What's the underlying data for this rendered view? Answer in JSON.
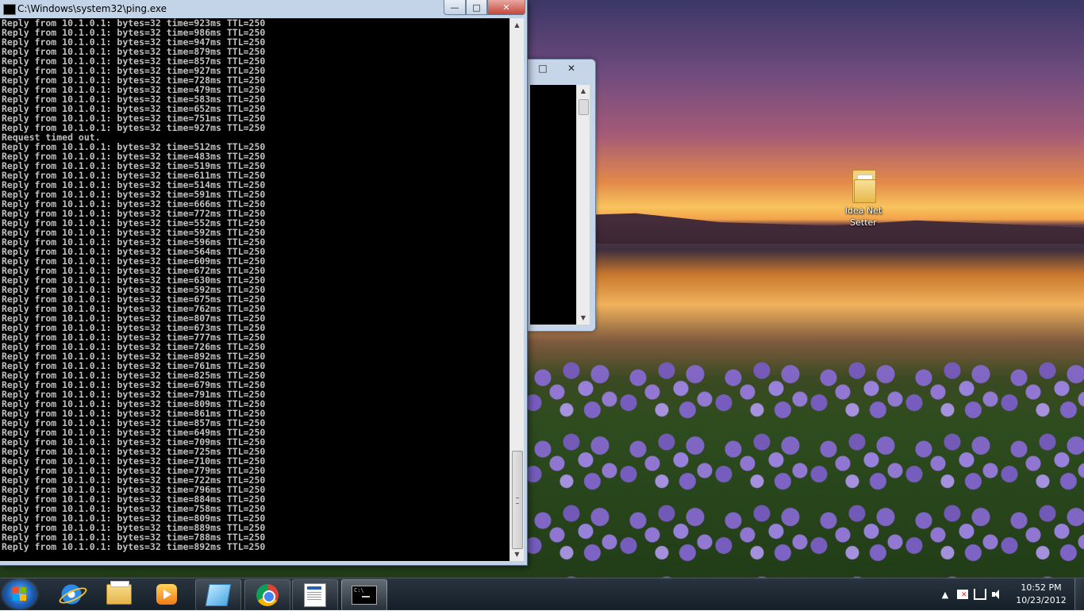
{
  "main_window": {
    "title": "C:\\Windows\\system32\\ping.exe",
    "buttons": {
      "minimize": "—",
      "maximize": "□",
      "close": "✕"
    },
    "console_lines": [
      "Reply from 10.1.0.1: bytes=32 time=923ms TTL=250",
      "Reply from 10.1.0.1: bytes=32 time=986ms TTL=250",
      "Reply from 10.1.0.1: bytes=32 time=947ms TTL=250",
      "Reply from 10.1.0.1: bytes=32 time=879ms TTL=250",
      "Reply from 10.1.0.1: bytes=32 time=857ms TTL=250",
      "Reply from 10.1.0.1: bytes=32 time=927ms TTL=250",
      "Reply from 10.1.0.1: bytes=32 time=728ms TTL=250",
      "Reply from 10.1.0.1: bytes=32 time=479ms TTL=250",
      "Reply from 10.1.0.1: bytes=32 time=583ms TTL=250",
      "Reply from 10.1.0.1: bytes=32 time=652ms TTL=250",
      "Reply from 10.1.0.1: bytes=32 time=751ms TTL=250",
      "Reply from 10.1.0.1: bytes=32 time=927ms TTL=250",
      "Request timed out.",
      "Reply from 10.1.0.1: bytes=32 time=512ms TTL=250",
      "Reply from 10.1.0.1: bytes=32 time=483ms TTL=250",
      "Reply from 10.1.0.1: bytes=32 time=519ms TTL=250",
      "Reply from 10.1.0.1: bytes=32 time=611ms TTL=250",
      "Reply from 10.1.0.1: bytes=32 time=514ms TTL=250",
      "Reply from 10.1.0.1: bytes=32 time=591ms TTL=250",
      "Reply from 10.1.0.1: bytes=32 time=666ms TTL=250",
      "Reply from 10.1.0.1: bytes=32 time=772ms TTL=250",
      "Reply from 10.1.0.1: bytes=32 time=552ms TTL=250",
      "Reply from 10.1.0.1: bytes=32 time=592ms TTL=250",
      "Reply from 10.1.0.1: bytes=32 time=596ms TTL=250",
      "Reply from 10.1.0.1: bytes=32 time=564ms TTL=250",
      "Reply from 10.1.0.1: bytes=32 time=609ms TTL=250",
      "Reply from 10.1.0.1: bytes=32 time=672ms TTL=250",
      "Reply from 10.1.0.1: bytes=32 time=630ms TTL=250",
      "Reply from 10.1.0.1: bytes=32 time=592ms TTL=250",
      "Reply from 10.1.0.1: bytes=32 time=675ms TTL=250",
      "Reply from 10.1.0.1: bytes=32 time=762ms TTL=250",
      "Reply from 10.1.0.1: bytes=32 time=807ms TTL=250",
      "Reply from 10.1.0.1: bytes=32 time=673ms TTL=250",
      "Reply from 10.1.0.1: bytes=32 time=777ms TTL=250",
      "Reply from 10.1.0.1: bytes=32 time=726ms TTL=250",
      "Reply from 10.1.0.1: bytes=32 time=892ms TTL=250",
      "Reply from 10.1.0.1: bytes=32 time=761ms TTL=250",
      "Reply from 10.1.0.1: bytes=32 time=825ms TTL=250",
      "Reply from 10.1.0.1: bytes=32 time=679ms TTL=250",
      "Reply from 10.1.0.1: bytes=32 time=791ms TTL=250",
      "Reply from 10.1.0.1: bytes=32 time=809ms TTL=250",
      "Reply from 10.1.0.1: bytes=32 time=861ms TTL=250",
      "Reply from 10.1.0.1: bytes=32 time=857ms TTL=250",
      "Reply from 10.1.0.1: bytes=32 time=649ms TTL=250",
      "Reply from 10.1.0.1: bytes=32 time=709ms TTL=250",
      "Reply from 10.1.0.1: bytes=32 time=725ms TTL=250",
      "Reply from 10.1.0.1: bytes=32 time=710ms TTL=250",
      "Reply from 10.1.0.1: bytes=32 time=779ms TTL=250",
      "Reply from 10.1.0.1: bytes=32 time=722ms TTL=250",
      "Reply from 10.1.0.1: bytes=32 time=796ms TTL=250",
      "Reply from 10.1.0.1: bytes=32 time=884ms TTL=250",
      "Reply from 10.1.0.1: bytes=32 time=758ms TTL=250",
      "Reply from 10.1.0.1: bytes=32 time=809ms TTL=250",
      "Reply from 10.1.0.1: bytes=32 time=889ms TTL=250",
      "Reply from 10.1.0.1: bytes=32 time=788ms TTL=250",
      "Reply from 10.1.0.1: bytes=32 time=892ms TTL=250"
    ]
  },
  "background_window": {
    "buttons": {
      "maximize": "□",
      "close": "✕"
    }
  },
  "desktop": {
    "icons": [
      {
        "label": "Idea Net Setter",
        "icon": "folder-icon"
      }
    ]
  },
  "taskbar": {
    "items": [
      {
        "name": "internet-explorer",
        "icon": "ie-icon"
      },
      {
        "name": "windows-explorer",
        "icon": "folder-icon"
      },
      {
        "name": "media-player",
        "icon": "media-icon"
      },
      {
        "name": "notes",
        "icon": "notes-icon"
      },
      {
        "name": "chrome",
        "icon": "chrome-icon"
      },
      {
        "name": "document",
        "icon": "doc-icon"
      },
      {
        "name": "command-prompt",
        "icon": "cmd-icon"
      }
    ],
    "tray": {
      "expand": "▲",
      "time": "10:52 PM",
      "date": "10/23/2012"
    }
  },
  "colors": {
    "console_bg": "#000000",
    "console_text": "#c0c0c0",
    "window_frame": "#c3d3e8",
    "close_button": "#c4483b"
  }
}
